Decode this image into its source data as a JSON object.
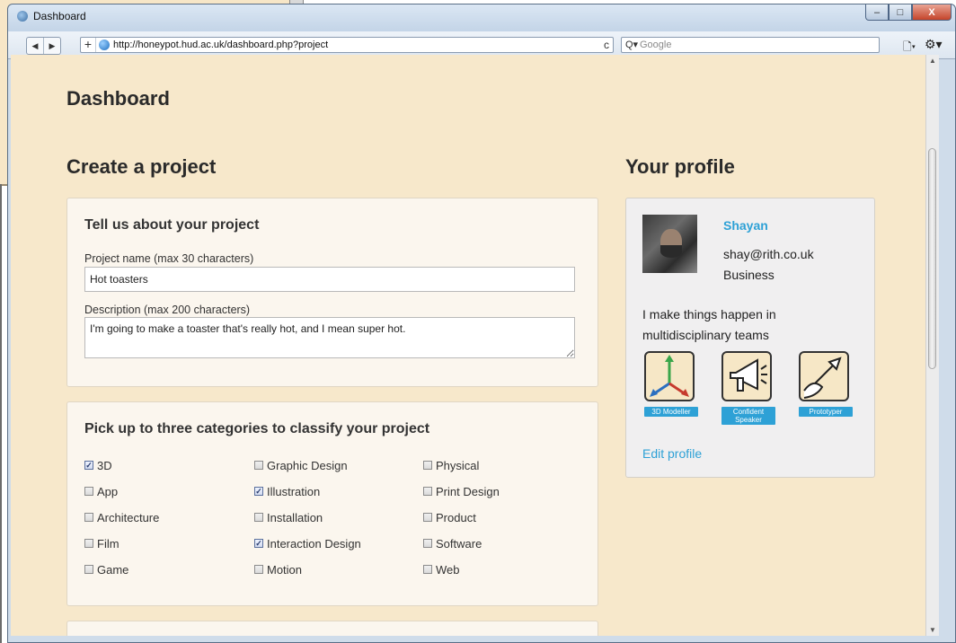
{
  "window": {
    "title": "Dashboard",
    "controls": {
      "minimize": "–",
      "maximize": "□",
      "close": "X"
    }
  },
  "browser": {
    "back": "◀",
    "forward": "▶",
    "new_tab": "+",
    "url": "http://honeypot.hud.ac.uk/dashboard.php?project",
    "reload": "c",
    "search_prefix": "Q▾",
    "search_placeholder": "Google"
  },
  "page": {
    "title": "Dashboard",
    "create_heading": "Create a project",
    "profile_heading": "Your profile"
  },
  "project_form": {
    "heading": "Tell us about your project",
    "name_label": "Project name (max 30 characters)",
    "name_value": "Hot toasters",
    "description_label": "Description (max 200 characters)",
    "description_value": "I'm going to make a toaster that's really hot, and I mean super hot."
  },
  "categories": {
    "heading": "Pick up to three categories to classify your project",
    "columns": [
      [
        {
          "label": "3D",
          "checked": true
        },
        {
          "label": "App",
          "checked": false
        },
        {
          "label": "Architecture",
          "checked": false
        },
        {
          "label": "Film",
          "checked": false
        },
        {
          "label": "Game",
          "checked": false
        }
      ],
      [
        {
          "label": "Graphic Design",
          "checked": false
        },
        {
          "label": "Illustration",
          "checked": true
        },
        {
          "label": "Installation",
          "checked": false
        },
        {
          "label": "Interaction Design",
          "checked": true
        },
        {
          "label": "Motion",
          "checked": false
        }
      ],
      [
        {
          "label": "Physical",
          "checked": false
        },
        {
          "label": "Print Design",
          "checked": false
        },
        {
          "label": "Product",
          "checked": false
        },
        {
          "label": "Software",
          "checked": false
        },
        {
          "label": "Web",
          "checked": false
        }
      ]
    ]
  },
  "profile": {
    "name": "Shayan",
    "email": "shay@rith.co.uk",
    "role": "Business",
    "bio": "I make things happen in multidisciplinary teams",
    "badges": [
      {
        "label": "3D Modeller",
        "icon": "axes-icon"
      },
      {
        "label": "Confident Speaker",
        "icon": "megaphone-icon"
      },
      {
        "label": "Prototyper",
        "icon": "cursor-arrow-icon"
      }
    ],
    "edit_label": "Edit profile"
  },
  "colors": {
    "page_bg": "#f7e8cb",
    "link": "#2ea1d6"
  }
}
